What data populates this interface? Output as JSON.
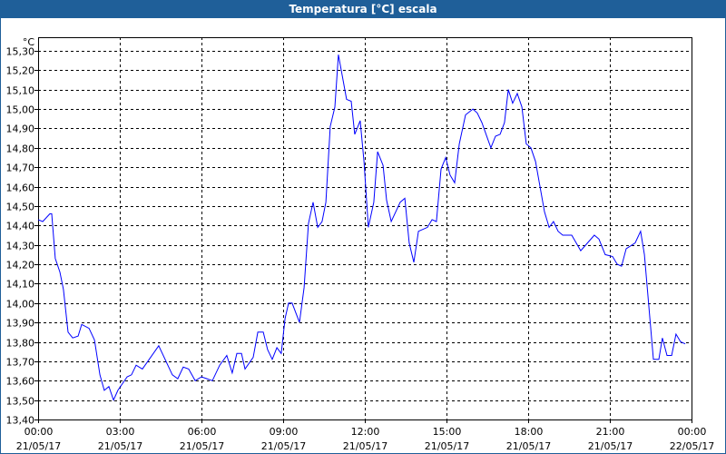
{
  "window": {
    "title": "Temperatura [°C] escala"
  },
  "chart_data": {
    "type": "line",
    "title": "Temperatura [°C] escala",
    "ylabel": "°C",
    "xlabel": "",
    "ylim": [
      13.4,
      15.35
    ],
    "xlim_hours": [
      0,
      24
    ],
    "grid": true,
    "line_color": "#0000ff",
    "yticks": [
      "13,40",
      "13,50",
      "13,60",
      "13,70",
      "13,80",
      "13,90",
      "14,00",
      "14,10",
      "14,20",
      "14,30",
      "14,40",
      "14,50",
      "14,60",
      "14,70",
      "14,80",
      "14,90",
      "15,00",
      "15,10",
      "15,20",
      "15,30"
    ],
    "ytick_values": [
      13.4,
      13.5,
      13.6,
      13.7,
      13.8,
      13.9,
      14.0,
      14.1,
      14.2,
      14.3,
      14.4,
      14.5,
      14.6,
      14.7,
      14.8,
      14.9,
      15.0,
      15.1,
      15.2,
      15.3
    ],
    "xticks": [
      {
        "time": "00:00",
        "date": "21/05/17",
        "hour": 0
      },
      {
        "time": "03:00",
        "date": "21/05/17",
        "hour": 3
      },
      {
        "time": "06:00",
        "date": "21/05/17",
        "hour": 6
      },
      {
        "time": "09:00",
        "date": "21/05/17",
        "hour": 9
      },
      {
        "time": "12:00",
        "date": "21/05/17",
        "hour": 12
      },
      {
        "time": "15:00",
        "date": "21/05/17",
        "hour": 15
      },
      {
        "time": "18:00",
        "date": "21/05/17",
        "hour": 18
      },
      {
        "time": "21:00",
        "date": "21/05/17",
        "hour": 21
      },
      {
        "time": "00:00",
        "date": "22/05/17",
        "hour": 24
      }
    ],
    "series": [
      {
        "name": "Temperatura",
        "x_hours": [
          0,
          0.17,
          0.43,
          0.5,
          0.63,
          0.8,
          0.93,
          1.1,
          1.27,
          1.47,
          1.6,
          1.87,
          2.07,
          2.27,
          2.43,
          2.6,
          2.77,
          2.93,
          3.27,
          3.43,
          3.6,
          3.83,
          4.43,
          4.93,
          5.13,
          5.33,
          5.53,
          5.77,
          6,
          6.2,
          6.4,
          6.67,
          6.93,
          7.13,
          7.3,
          7.47,
          7.6,
          7.9,
          8.07,
          8.27,
          8.43,
          8.6,
          8.77,
          8.93,
          9.07,
          9.2,
          9.33,
          9.6,
          9.77,
          9.93,
          10.1,
          10.27,
          10.43,
          10.57,
          10.73,
          10.9,
          11.03,
          11.33,
          11.5,
          11.63,
          11.83,
          11.97,
          12.13,
          12.33,
          12.47,
          12.67,
          12.8,
          12.97,
          13.3,
          13.47,
          13.63,
          13.8,
          13.97,
          14.3,
          14.47,
          14.63,
          14.8,
          14.97,
          15.13,
          15.3,
          15.47,
          15.7,
          15.97,
          16.13,
          16.3,
          16.63,
          16.8,
          16.97,
          17.13,
          17.27,
          17.43,
          17.6,
          17.77,
          17.93,
          18.1,
          18.27,
          18.6,
          18.77,
          18.93,
          19.1,
          19.27,
          19.6,
          19.93,
          20.43,
          20.6,
          20.83,
          21.1,
          21.27,
          21.43,
          21.6,
          21.93,
          22.13,
          22.27,
          22.6,
          22.8,
          22.93,
          23.1,
          23.27,
          23.43,
          23.6,
          23.77
        ],
        "values": [
          14.43,
          14.42,
          14.46,
          14.46,
          14.23,
          14.16,
          14.07,
          13.85,
          13.82,
          13.83,
          13.89,
          13.87,
          13.81,
          13.63,
          13.55,
          13.57,
          13.5,
          13.55,
          13.62,
          13.63,
          13.68,
          13.66,
          13.78,
          13.63,
          13.61,
          13.67,
          13.66,
          13.6,
          13.62,
          13.61,
          13.6,
          13.68,
          13.73,
          13.64,
          13.74,
          13.74,
          13.66,
          13.72,
          13.85,
          13.85,
          13.76,
          13.71,
          13.77,
          13.74,
          13.92,
          14.0,
          14.0,
          13.9,
          14.08,
          14.41,
          14.52,
          14.39,
          14.42,
          14.52,
          14.91,
          15.01,
          15.28,
          15.05,
          15.04,
          14.87,
          14.94,
          14.73,
          14.39,
          14.52,
          14.78,
          14.71,
          14.53,
          14.42,
          14.52,
          14.54,
          14.31,
          14.21,
          14.37,
          14.39,
          14.43,
          14.42,
          14.69,
          14.75,
          14.66,
          14.62,
          14.82,
          14.97,
          15.0,
          14.98,
          14.93,
          14.8,
          14.86,
          14.87,
          14.93,
          15.1,
          15.03,
          15.08,
          15.01,
          14.82,
          14.8,
          14.73,
          14.47,
          14.39,
          14.42,
          14.37,
          14.35,
          14.35,
          14.27,
          14.35,
          14.33,
          14.25,
          14.24,
          14.2,
          14.19,
          14.28,
          14.31,
          14.37,
          14.25,
          13.71,
          13.71,
          13.82,
          13.73,
          13.73,
          13.84,
          13.8,
          13.79
        ]
      }
    ]
  }
}
